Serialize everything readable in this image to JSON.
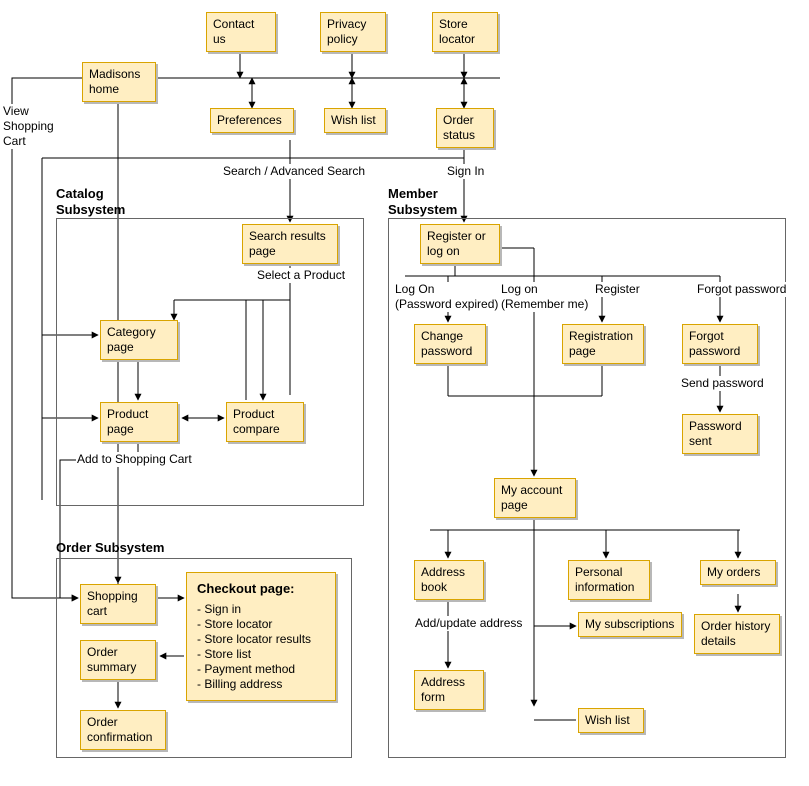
{
  "nodes": {
    "madisons_home": "Madisons home",
    "contact_us": "Contact us",
    "privacy_policy": "Privacy policy",
    "store_locator": "Store locator",
    "preferences": "Preferences",
    "wish_list_top": "Wish list",
    "order_status": "Order status",
    "search_results": "Search results page",
    "category_page": "Category page",
    "product_page": "Product page",
    "product_compare": "Product compare",
    "register_or_log_on": "Register or log on",
    "change_password": "Change password",
    "registration_page": "Registration page",
    "forgot_password": "Forgot password",
    "password_sent": "Password sent",
    "my_account_page": "My account page",
    "address_book": "Address book",
    "personal_info": "Personal information",
    "my_orders": "My orders",
    "my_subscriptions": "My subscriptions",
    "order_history": "Order history details",
    "address_form": "Address form",
    "wish_list_member": "Wish list",
    "shopping_cart": "Shopping cart",
    "order_summary": "Order summary",
    "order_confirmation": "Order confirmation"
  },
  "subsystems": {
    "catalog": "Catalog Subsystem",
    "member": "Member Subsystem",
    "order": "Order Subsystem"
  },
  "checkout": {
    "title": "Checkout page:",
    "items": [
      "Sign in",
      "Store locator",
      "Store locator results",
      "Store list",
      "Payment method",
      "Billing address"
    ]
  },
  "edge_labels": {
    "view_cart": "View Shopping Cart",
    "search": "Search / Advanced Search",
    "sign_in": "Sign In",
    "select_product": "Select a Product",
    "add_to_cart": "Add to Shopping Cart",
    "log_on_expired": "Log On\n(Password expired)",
    "log_on_remember": "Log on\n(Remember me)",
    "register": "Register",
    "forgot_pw": "Forgot password",
    "send_pw": "Send password",
    "add_update_addr": "Add/update address"
  }
}
